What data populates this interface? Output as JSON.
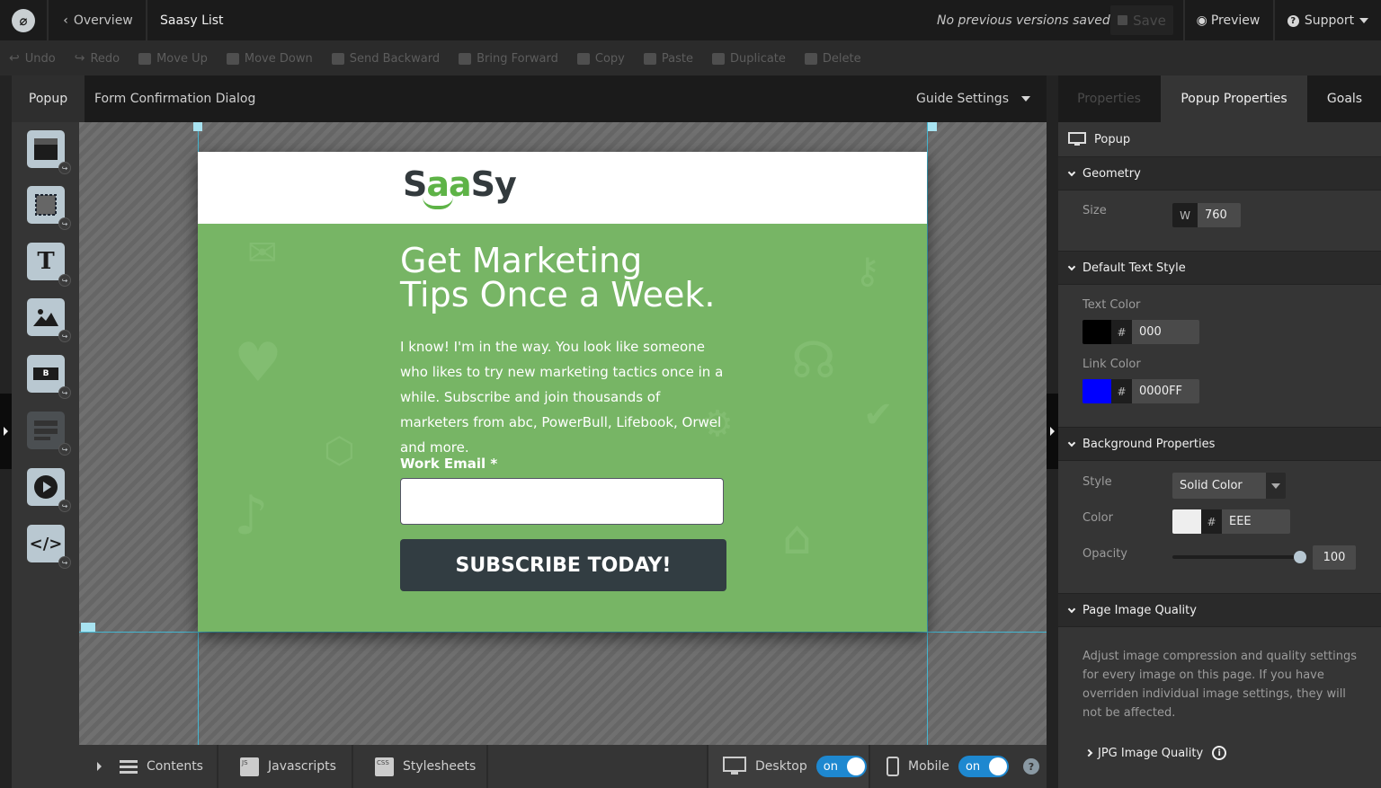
{
  "topbar": {
    "back_label": "Overview",
    "page_name": "Saasy List",
    "versions_status": "No previous versions saved",
    "save_label": "Save",
    "preview_label": "Preview",
    "support_label": "Support"
  },
  "toolbar": {
    "items": [
      {
        "label": "Undo",
        "icon": "undo-icon"
      },
      {
        "label": "Redo",
        "icon": "redo-icon"
      },
      {
        "label": "Move Up",
        "icon": "move-up-icon"
      },
      {
        "label": "Move Down",
        "icon": "move-down-icon"
      },
      {
        "label": "Send Backward",
        "icon": "send-backward-icon"
      },
      {
        "label": "Bring Forward",
        "icon": "bring-forward-icon"
      },
      {
        "label": "Copy",
        "icon": "copy-icon"
      },
      {
        "label": "Paste",
        "icon": "paste-icon"
      },
      {
        "label": "Duplicate",
        "icon": "duplicate-icon"
      },
      {
        "label": "Delete",
        "icon": "trash-icon"
      }
    ]
  },
  "editor_tabs": {
    "popup_tab": "Popup",
    "dialog_name": "Form Confirmation Dialog",
    "guide_settings": "Guide Settings"
  },
  "tools": [
    {
      "name": "section-tool",
      "icon": "section-icon"
    },
    {
      "name": "box-tool",
      "icon": "box-icon"
    },
    {
      "name": "text-tool",
      "icon": "text-icon",
      "glyph": "T"
    },
    {
      "name": "image-tool",
      "icon": "image-icon"
    },
    {
      "name": "button-tool",
      "icon": "button-icon",
      "glyph": "B"
    },
    {
      "name": "form-tool",
      "icon": "form-icon",
      "disabled": true
    },
    {
      "name": "video-tool",
      "icon": "video-icon"
    },
    {
      "name": "custom-html-tool",
      "icon": "code-icon",
      "glyph": "</>"
    }
  ],
  "popup": {
    "brand_parts": [
      "S",
      "aa",
      "Sy"
    ],
    "headline_line1": "Get Marketing",
    "headline_line2": "Tips Once a Week.",
    "paragraph": "I know! I'm in the way. You look like someone who likes to try new marketing tactics once in a while. Subscribe and join thousands of marketers from abc, PowerBull, Lifebook, Orwel and more.",
    "email_label": "Work Email *",
    "email_value": "",
    "submit_label": "SUBSCRIBE TODAY!",
    "colors": {
      "header_bg": "#FFFFFF",
      "body_bg": "#77B565",
      "button_bg": "#323D42",
      "brand_green": "#5EB347"
    }
  },
  "right_panel": {
    "tabs": [
      "Properties",
      "Popup Properties",
      "Goals"
    ],
    "active_tab": "Popup Properties",
    "element_title": "Popup",
    "geometry": {
      "title": "Geometry",
      "size_label": "Size",
      "width_prefix": "W",
      "width_value": "760"
    },
    "default_text_style": {
      "title": "Default Text Style",
      "text_color_label": "Text Color",
      "text_color_value": "000",
      "text_color_hex": "#000000",
      "link_color_label": "Link Color",
      "link_color_value": "0000FF",
      "link_color_hex": "#0000FF",
      "hash": "#"
    },
    "background": {
      "title": "Background Properties",
      "style_label": "Style",
      "style_value": "Solid Color",
      "color_label": "Color",
      "color_value": "EEE",
      "color_hex": "#EEEEEE",
      "opacity_label": "Opacity",
      "opacity_value": "100",
      "opacity_fraction": 1.0
    },
    "image_quality": {
      "title": "Page Image Quality",
      "description": "Adjust image compression and quality settings for every image on this page. If you have overriden individual image settings, they will not be affected.",
      "jpg_label": "JPG Image Quality"
    }
  },
  "bottom_bar": {
    "contents_label": "Contents",
    "javascripts_label": "Javascripts",
    "javascripts_badge": "JS",
    "stylesheets_label": "Stylesheets",
    "stylesheets_badge": "CSS",
    "desktop_label": "Desktop",
    "desktop_toggle": "on",
    "mobile_label": "Mobile",
    "mobile_toggle": "on",
    "help": "?"
  }
}
